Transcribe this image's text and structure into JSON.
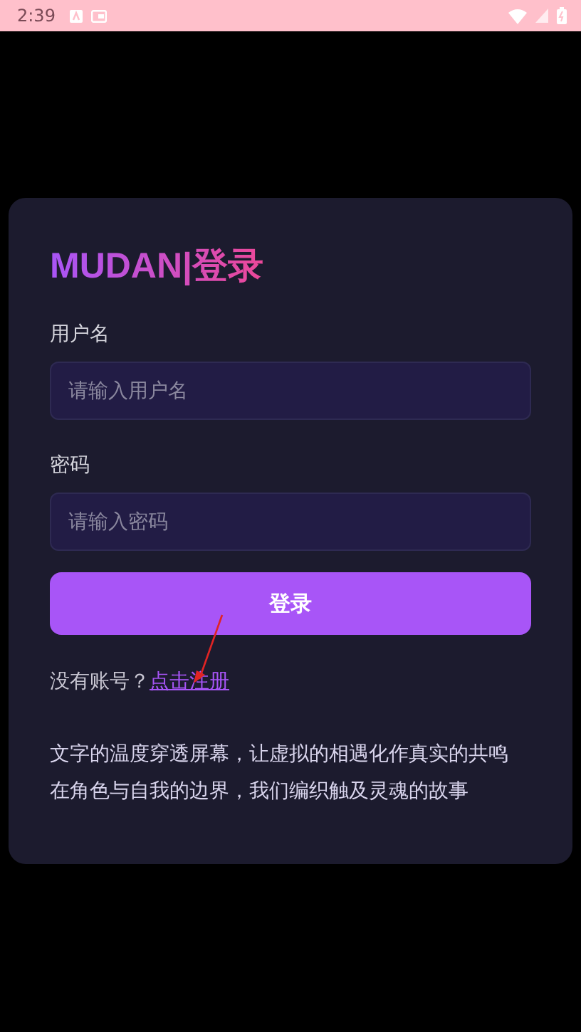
{
  "status_bar": {
    "time": "2:39"
  },
  "login_card": {
    "title": "MUDAN|登录",
    "fields": [
      {
        "label": "用户名",
        "placeholder": "请输入用户名"
      },
      {
        "label": "密码",
        "placeholder": "请输入密码"
      }
    ],
    "submit_button": "登录",
    "register_prompt": "没有账号？",
    "register_link": "点击注册",
    "slogan": [
      "文字的温度穿透屏幕，让虚拟的相遇化作真实的共鸣",
      "在角色与自我的边界，我们编织触及灵魂的故事"
    ]
  }
}
